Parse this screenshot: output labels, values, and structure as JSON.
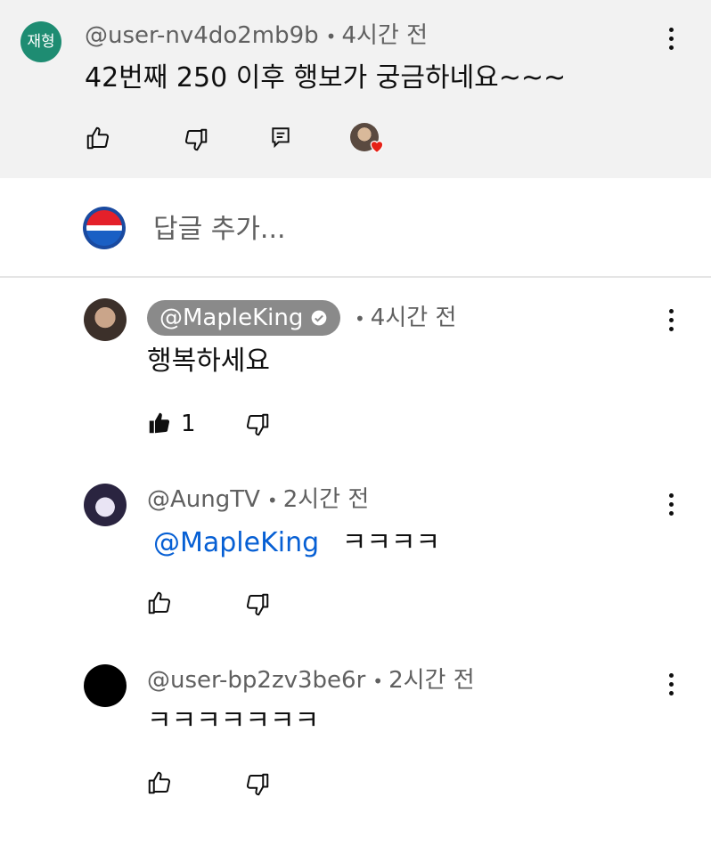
{
  "top_comment": {
    "avatar_text": "재형",
    "avatar_color": "#1e8c72",
    "handle": "@user-nv4do2mb9b",
    "time": "4시간 전",
    "text": "42번째 250 이후 행보가 궁금하네요~~~"
  },
  "reply_box": {
    "placeholder": "답글 추가..."
  },
  "replies": [
    {
      "handle": "@MapleKing",
      "time": "4시간 전",
      "text": "행복하세요",
      "like_count": "1"
    },
    {
      "handle": "@AungTV",
      "time": "2시간 전",
      "mention": "@MapleKing",
      "text": "ㅋㅋㅋㅋ"
    },
    {
      "handle": "@user-bp2zv3be6r",
      "time": "2시간 전",
      "text": "ㅋㅋㅋㅋㅋㅋㅋ"
    }
  ],
  "separator": "•",
  "colors": {
    "mention": "#065fd4",
    "heart": "#e62117",
    "creator_pill": "#8a8a8a"
  }
}
